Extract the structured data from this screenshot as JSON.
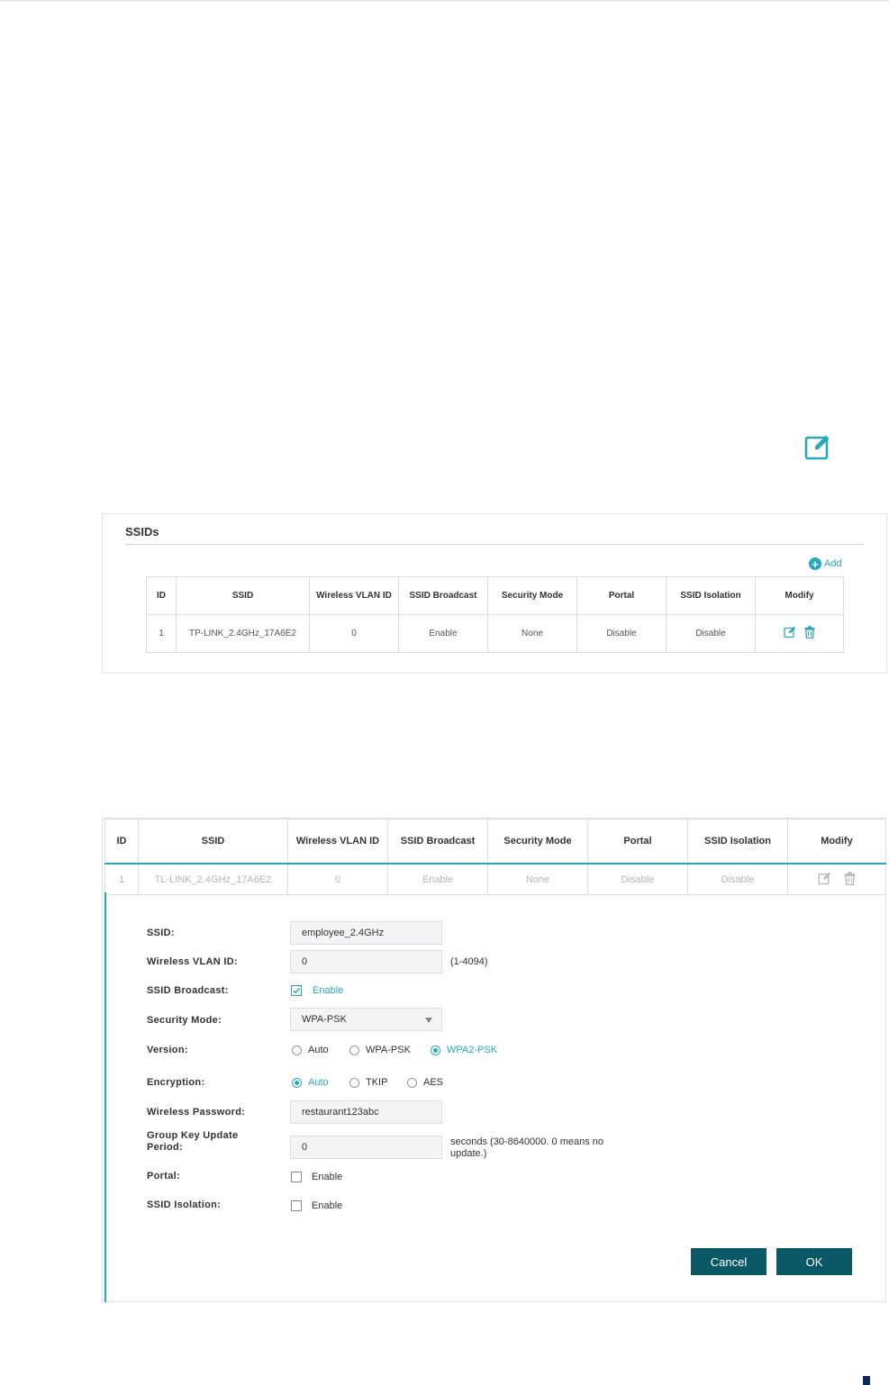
{
  "colors": {
    "accent": "#27a9b9",
    "button": "#0b5866",
    "border": "#d8dee3"
  },
  "panel1": {
    "title": "SSIDs",
    "add_label": "Add",
    "columns": [
      "ID",
      "SSID",
      "Wireless VLAN ID",
      "SSID Broadcast",
      "Security Mode",
      "Portal",
      "SSID Isolation",
      "Modify"
    ],
    "rows": [
      {
        "id": "1",
        "ssid": "TP-LINK_2.4GHz_17A6E2",
        "vlan": "0",
        "broadcast": "Enable",
        "security": "None",
        "portal": "Disable",
        "isolation": "Disable"
      }
    ]
  },
  "panel2": {
    "columns": [
      "ID",
      "SSID",
      "Wireless VLAN ID",
      "SSID Broadcast",
      "Security Mode",
      "Portal",
      "SSID Isolation",
      "Modify"
    ],
    "rows": [
      {
        "id": "1",
        "ssid": "TL-LINK_2.4GHz_17A6E2",
        "vlan": "0",
        "broadcast": "Enable",
        "security": "None",
        "portal": "Disable",
        "isolation": "Disable"
      }
    ],
    "form": {
      "ssid_label": "SSID:",
      "ssid_value": "employee_2.4GHz",
      "vlan_label": "Wireless VLAN ID:",
      "vlan_value": "0",
      "vlan_hint": "(1-4094)",
      "broadcast_label": "SSID Broadcast:",
      "broadcast_option": "Enable",
      "broadcast_checked": true,
      "security_label": "Security Mode:",
      "security_value": "WPA-PSK",
      "version_label": "Version:",
      "version_options": [
        "Auto",
        "WPA-PSK",
        "WPA2-PSK"
      ],
      "version_selected": "WPA2-PSK",
      "encryption_label": "Encryption:",
      "encryption_options": [
        "Auto",
        "TKIP",
        "AES"
      ],
      "encryption_selected": "Auto",
      "password_label": "Wireless Password:",
      "password_value": "restaurant123abc",
      "gkup_label_line1": "Group Key Update",
      "gkup_label_line2": "Period:",
      "gkup_value": "0",
      "gkup_hint_line1": "seconds (30-8640000. 0 means no",
      "gkup_hint_line2": "update.)",
      "portal_label": "Portal:",
      "portal_option": "Enable",
      "isolation_label": "SSID Isolation:",
      "isolation_option": "Enable",
      "cancel_label": "Cancel",
      "ok_label": "OK"
    }
  }
}
